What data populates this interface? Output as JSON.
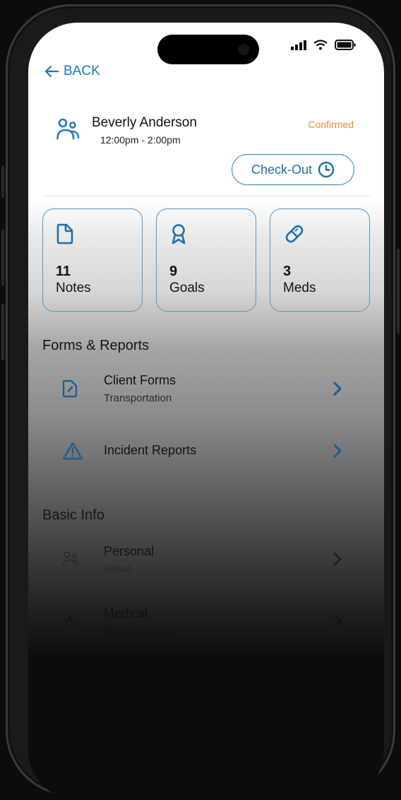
{
  "status_bar": {
    "icons": [
      "signal-icon",
      "wifi-icon",
      "battery-icon"
    ]
  },
  "nav": {
    "back_label": "BACK",
    "back_icon": "arrow-left-icon"
  },
  "client": {
    "name": "Beverly Anderson",
    "time": "12:00pm - 2:00pm",
    "status": "Confirmed",
    "icon": "users-icon"
  },
  "checkout": {
    "label": "Check-Out",
    "icon": "clock-icon"
  },
  "stats": [
    {
      "count": "11",
      "label": "Notes",
      "icon": "document-icon"
    },
    {
      "count": "9",
      "label": "Goals",
      "icon": "award-ribbon-icon"
    },
    {
      "count": "3",
      "label": "Meds",
      "icon": "pill-icon"
    }
  ],
  "sections": {
    "forms_reports": {
      "title": "Forms & Reports",
      "items": [
        {
          "title": "Client Forms",
          "subtitle": "Transportation",
          "icon": "file-edit-icon"
        },
        {
          "title": "Incident Reports",
          "subtitle": "",
          "icon": "warning-triangle-icon"
        }
      ]
    },
    "basic_info": {
      "title": "Basic Info",
      "items": [
        {
          "title": "Personal",
          "subtitle": "About",
          "icon": "users-icon"
        },
        {
          "title": "Medical",
          "subtitle": "Medical History",
          "icon": "pulse-icon"
        }
      ]
    }
  },
  "colors": {
    "accent": "#1f78b4",
    "status_confirmed": "#e98a2e",
    "card_border": "#5d95bd"
  }
}
